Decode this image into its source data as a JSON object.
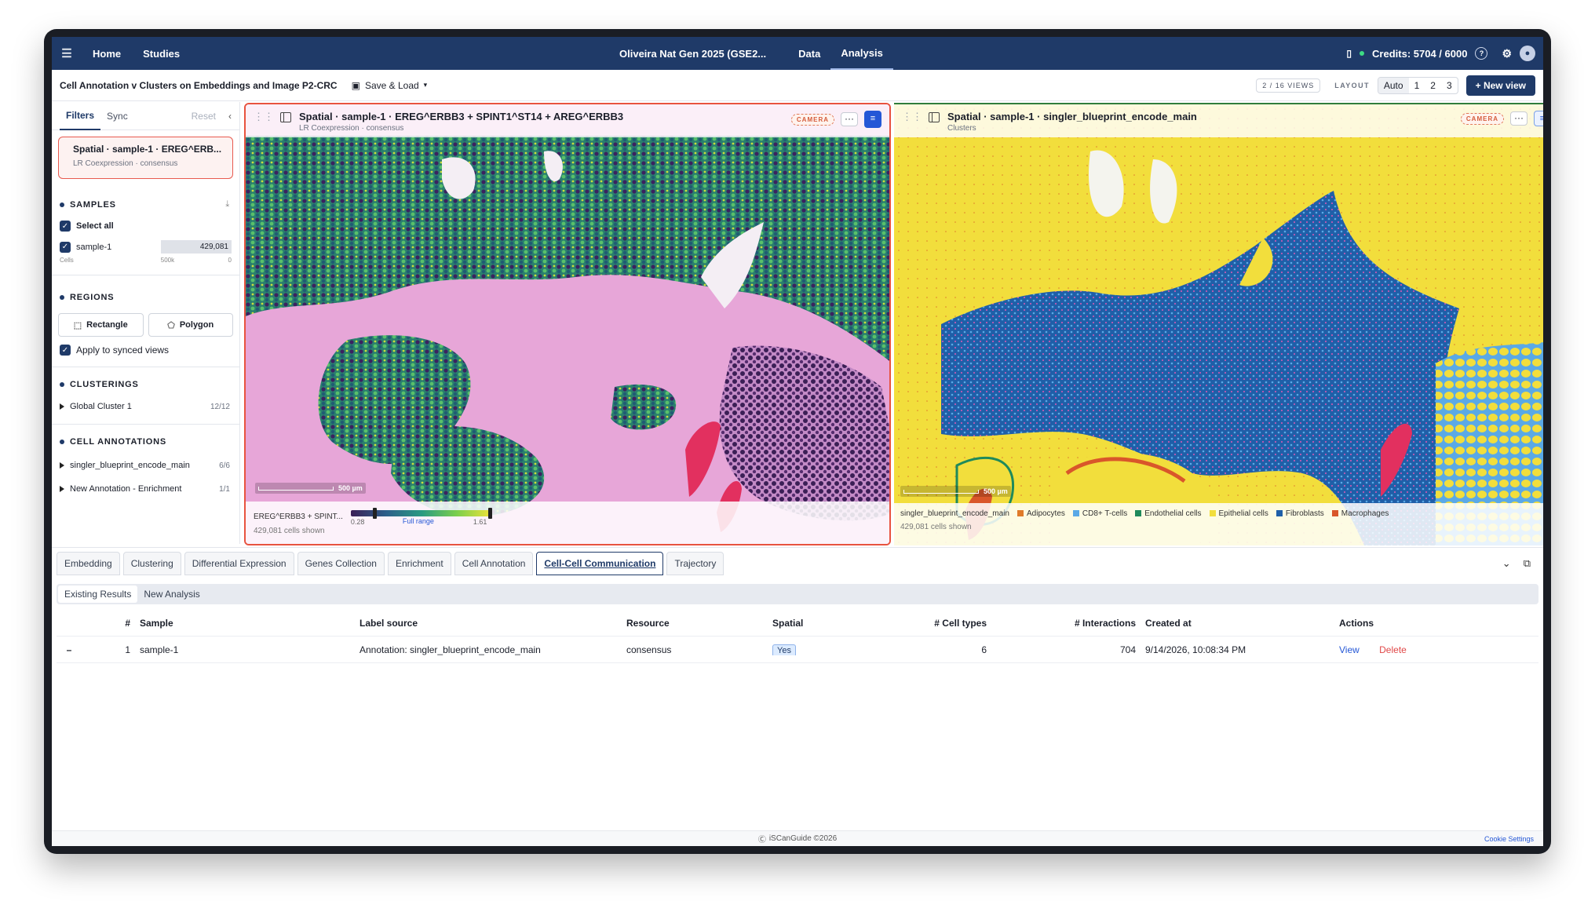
{
  "topbar": {
    "home": "Home",
    "studies": "Studies",
    "study_title": "Oliveira Nat Gen 2025 (GSE2...",
    "tab_data": "Data",
    "tab_analysis": "Analysis",
    "credits": "Credits: 5704 / 6000"
  },
  "subbar": {
    "title": "Cell Annotation v Clusters on Embeddings and Image P2-CRC",
    "save_load": "Save & Load",
    "views": "2 / 16 VIEWS",
    "layout_label": "LAYOUT",
    "layout_options": [
      "Auto",
      "1",
      "2",
      "3"
    ],
    "new_view": "New view"
  },
  "sidebar": {
    "tab_filters": "Filters",
    "tab_sync": "Sync",
    "reset": "Reset",
    "selected_title": "Spatial · sample-1 · EREG^ERB...",
    "selected_sub": "LR Coexpression · consensus",
    "samples_header": "SAMPLES",
    "select_all": "Select all",
    "sample_name": "sample-1",
    "sample_count": "429,081",
    "cells_label": "Cells",
    "cells_max": "500k",
    "cells_min": "0",
    "regions_header": "REGIONS",
    "rectangle": "Rectangle",
    "polygon": "Polygon",
    "apply_synced": "Apply to synced views",
    "clusterings_header": "CLUSTERINGS",
    "global_cluster": "Global Cluster 1",
    "global_cluster_count": "12/12",
    "cell_annotations_header": "CELL ANNOTATIONS",
    "ann1": "singler_blueprint_encode_main",
    "ann1_count": "6/6",
    "ann2": "New Annotation - Enrichment",
    "ann2_count": "1/1"
  },
  "panel1": {
    "title": "Spatial · sample-1 · EREG^ERBB3 + SPINT1^ST14 + AREG^ERBB3",
    "subtitle": "LR Coexpression · consensus",
    "camera": "CAMERA",
    "scale": "500 µm",
    "legend_label": "EREG^ERBB3 + SPINT...",
    "range_min": "0.28",
    "range_mid": "Full range",
    "range_max": "1.61",
    "cells_shown": "429,081 cells shown"
  },
  "panel2": {
    "title": "Spatial · sample-1 · singler_blueprint_encode_main",
    "subtitle": "Clusters",
    "camera": "CAMERA",
    "scale": "500 µm",
    "legend_label": "singler_blueprint_encode_main",
    "legend": [
      {
        "name": "Adipocytes",
        "color": "#e07b2a"
      },
      {
        "name": "CD8+ T-cells",
        "color": "#5aa9e6"
      },
      {
        "name": "Endothelial cells",
        "color": "#1f8a5b"
      },
      {
        "name": "Epithelial cells",
        "color": "#f2de3c"
      },
      {
        "name": "Fibroblasts",
        "color": "#1f5fa8"
      },
      {
        "name": "Macrophages",
        "color": "#d9562a"
      }
    ],
    "cells_shown": "429,081 cells shown"
  },
  "bottom_tabs": [
    "Embedding",
    "Clustering",
    "Differential Expression",
    "Genes Collection",
    "Enrichment",
    "Cell Annotation",
    "Cell-Cell Communication",
    "Trajectory"
  ],
  "results_tabs": {
    "existing": "Existing Results",
    "new": "New Analysis"
  },
  "table": {
    "headers": [
      "#",
      "Sample",
      "Label source",
      "Resource",
      "Spatial",
      "# Cell types",
      "# Interactions",
      "Created at",
      "Actions"
    ],
    "row": {
      "collapse": "–",
      "num": "1",
      "sample": "sample-1",
      "label_source": "Annotation: singler_blueprint_encode_main",
      "resource": "consensus",
      "spatial": "Yes",
      "cell_types": "6",
      "interactions": "704",
      "created_at": "9/14/2026, 10:08:34 PM",
      "view": "View",
      "delete": "Delete"
    }
  },
  "footer": {
    "brand": "iSCanGuide ©2026",
    "cookie": "Cookie Settings"
  },
  "colors": {
    "navy": "#1f3a68",
    "active_panel_border": "#e8533f",
    "delete": "#e04848"
  }
}
